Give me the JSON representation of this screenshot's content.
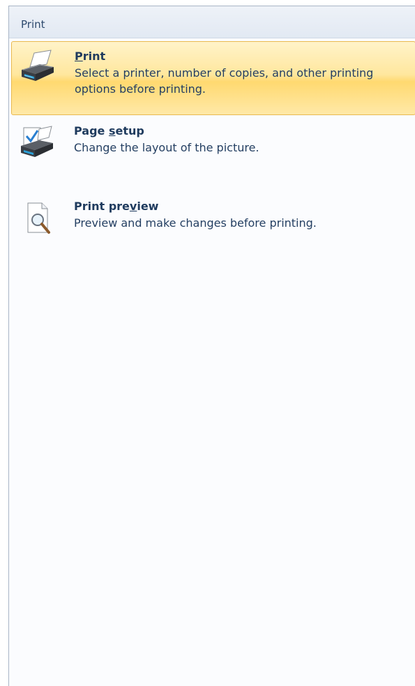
{
  "panel": {
    "title": "Print"
  },
  "items": [
    {
      "title_pre": "",
      "title_key": "P",
      "title_post": "rint",
      "description": "Select a printer, number of copies, and other printing options before printing.",
      "icon": "printer-icon",
      "selected": true
    },
    {
      "title_pre": "Page ",
      "title_key": "s",
      "title_post": "etup",
      "description": "Change the layout of the picture.",
      "icon": "page-setup-icon",
      "selected": false
    },
    {
      "title_pre": "Print pre",
      "title_key": "v",
      "title_post": "iew",
      "description": "Preview and make changes before printing.",
      "icon": "print-preview-icon",
      "selected": false
    }
  ],
  "colors": {
    "selected_border": "#e9b94f",
    "selected_fill": "#ffe79e",
    "text": "#1f3b5e"
  }
}
